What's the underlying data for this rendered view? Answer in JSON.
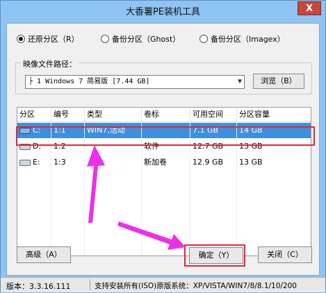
{
  "window": {
    "title": "大香薯PE装机工具",
    "close_label": "X"
  },
  "modes": [
    {
      "label": "还原分区（R）",
      "checked": true
    },
    {
      "label": "备份分区（Ghost）",
      "checked": false
    },
    {
      "label": "备份分区（Imagex）",
      "checked": false
    }
  ],
  "image_path": {
    "label": "映像文件路径：",
    "value": "├ 1 Windows 7 简易版 [7.44 GB]",
    "browse_label": "浏览（B）"
  },
  "table": {
    "columns": [
      "分区",
      "编号",
      "类型",
      "卷标",
      "可用空间",
      "分区容量"
    ],
    "rows": [
      {
        "drive": "C:",
        "number": "1:1",
        "type": "WIN7,活动",
        "label": "",
        "free": "7.1 GB",
        "capacity": "14 GB",
        "selected": true
      },
      {
        "drive": "D:",
        "number": "1:2",
        "type": "",
        "label": "软件",
        "free": "12.7 GB",
        "capacity": "13 GB",
        "selected": false
      },
      {
        "drive": "E:",
        "number": "1:3",
        "type": "",
        "label": "新加卷",
        "free": "12.9 GB",
        "capacity": "13 GB",
        "selected": false
      }
    ]
  },
  "buttons": {
    "advanced": "高级（A）",
    "ok": "确定（Y）",
    "close": "关闭（C）"
  },
  "status": {
    "version": "版本：3.3.16.111",
    "support": "支持安装所有(ISO)原版系统：XP/VISTA/WIN7/8/8.1/10/200"
  },
  "colors": {
    "selection": "#3d8fe0",
    "highlight": "#e0283a",
    "arrow": "#ee2fe8"
  }
}
